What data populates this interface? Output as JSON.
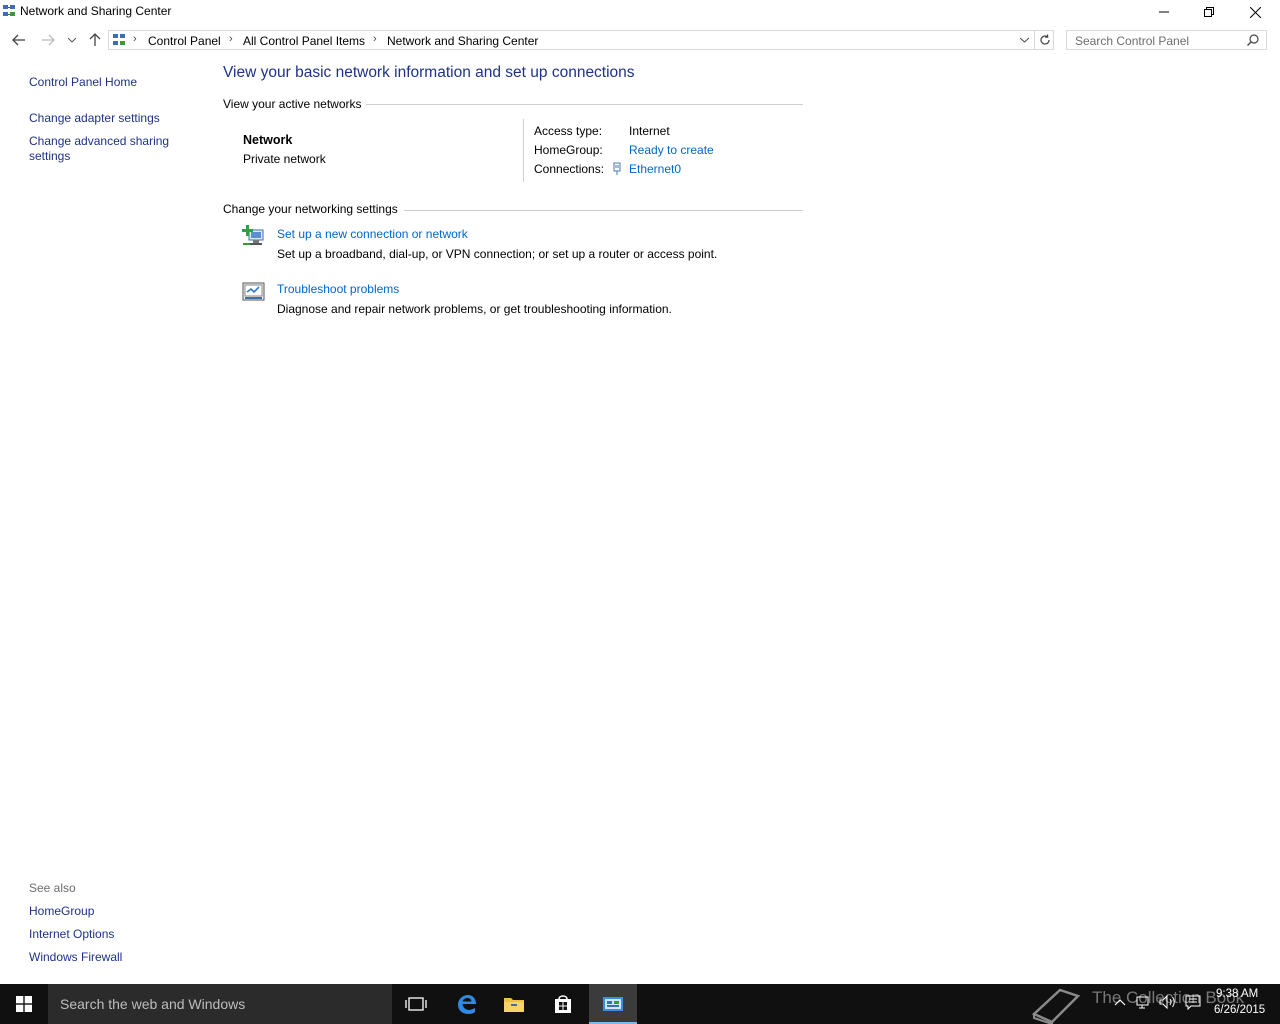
{
  "window": {
    "title": "Network and Sharing Center"
  },
  "address_bar": {
    "crumbs": [
      "Control Panel",
      "All Control Panel Items",
      "Network and Sharing Center"
    ],
    "separator": "›"
  },
  "search": {
    "placeholder": "Search Control Panel"
  },
  "left_pane": {
    "home": "Control Panel Home",
    "links": [
      "Change adapter settings",
      "Change advanced sharing",
      "settings"
    ],
    "see_also_label": "See also",
    "see_also": [
      "HomeGroup",
      "Internet Options",
      "Windows Firewall"
    ]
  },
  "main": {
    "title": "View your basic network information and set up connections",
    "active_networks_label": "View your active networks",
    "network": {
      "name": "Network",
      "type": "Private network",
      "access_type_label": "Access type:",
      "access_type_value": "Internet",
      "homegroup_label": "HomeGroup:",
      "homegroup_value": "Ready to create",
      "connections_label": "Connections:",
      "connections_value": "Ethernet0"
    },
    "change_settings_label": "Change your networking settings",
    "tasks": [
      {
        "title": "Set up a new connection or network",
        "description": "Set up a broadband, dial-up, or VPN connection; or set up a router or access point.",
        "icon": "new-connection-icon"
      },
      {
        "title": "Troubleshoot problems",
        "description": "Diagnose and repair network problems, or get troubleshooting information.",
        "icon": "troubleshoot-icon"
      }
    ]
  },
  "taskbar": {
    "search_placeholder": "Search the web and Windows",
    "time": "9:38 AM",
    "date": "6/26/2015",
    "watermark": "The Collection Book"
  },
  "colors": {
    "link": "#0066cc",
    "heading": "#1e3287",
    "taskbar": "#101010"
  }
}
